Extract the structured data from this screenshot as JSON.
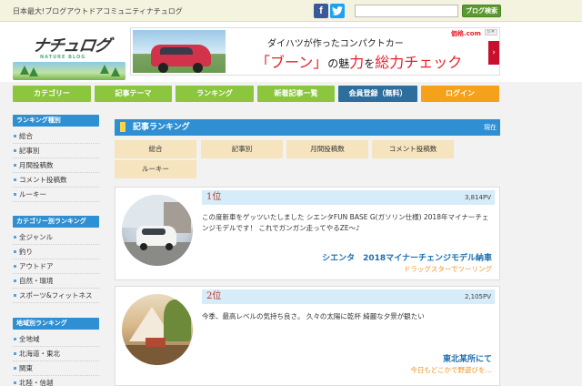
{
  "topbar": {
    "tagline": "日本最大!ブログアウトドアコミュニティナチュログ",
    "facebook_icon": "facebook-icon",
    "twitter_icon": "twitter-icon",
    "search_placeholder": "",
    "search_button": "ブログ検索"
  },
  "header": {
    "logo_text": "ナチュログ",
    "logo_sub": "NATURE BLOG",
    "banner": {
      "line1": "ダイハツが作ったコンパクトカー",
      "line2_a": "「ブーン」",
      "line2_b": "の魅",
      "line2_c": "力",
      "line2_d": "を",
      "line2_e": "総力チェック",
      "brand": "価格.com",
      "ad_icons": "▷✕"
    }
  },
  "nav": {
    "category": "カテゴリー",
    "theme": "記事テーマ",
    "ranking": "ランキング",
    "new_posts": "新着記事一覧",
    "register": "会員登録（無料）",
    "login": "ログイン"
  },
  "sidebar": {
    "ranking_type_title": "ランキング種別",
    "ranking_types": [
      "総合",
      "記事別",
      "月間投稿数",
      "コメント投稿数",
      "ルーキー"
    ],
    "category_title": "カテゴリー別ランキング",
    "categories": [
      "全ジャンル",
      "釣り",
      "アウトドア",
      "自然・環境",
      "スポーツ&フィットネス"
    ],
    "region_title": "地域別ランキング",
    "regions": [
      "全地域",
      "北海道・東北",
      "関東",
      "北陸・信越"
    ]
  },
  "main": {
    "title": "記事ランキング",
    "now_label": "現在",
    "filters": [
      "総合",
      "記事別",
      "月間投稿数",
      "コメント投稿数",
      "ルーキー"
    ],
    "entries": [
      {
        "rank": "1位",
        "pv": "3,814PV",
        "desc": "この度新車をゲッツいたしました シエンタFUN BASE G(ガソリン仕様) 2018年マイナーチェンジモデルです！ これでガンガン走ってやるZE〜♪",
        "title": "シエンタ　2018マイナーチェンジモデル納車",
        "author": "ドラッグスターでツーリング"
      },
      {
        "rank": "2位",
        "pv": "2,105PV",
        "desc": "今季、最高レベルの気持ち良さ。 久々の太陽に乾杯 綺麗な夕景が観たい",
        "title": "東北某所にて",
        "author": "今日もどこかで野遊びを…"
      }
    ]
  },
  "colors": {
    "nav_green": "#8cc63f",
    "nav_blue": "#2d6e9c",
    "nav_orange": "#f6a11a",
    "section_blue": "#2e8fd2",
    "filter_beige": "#f5e4be",
    "rank_red": "#c0392b",
    "title_blue": "#1a6fb0",
    "author_orange": "#e8962a"
  }
}
